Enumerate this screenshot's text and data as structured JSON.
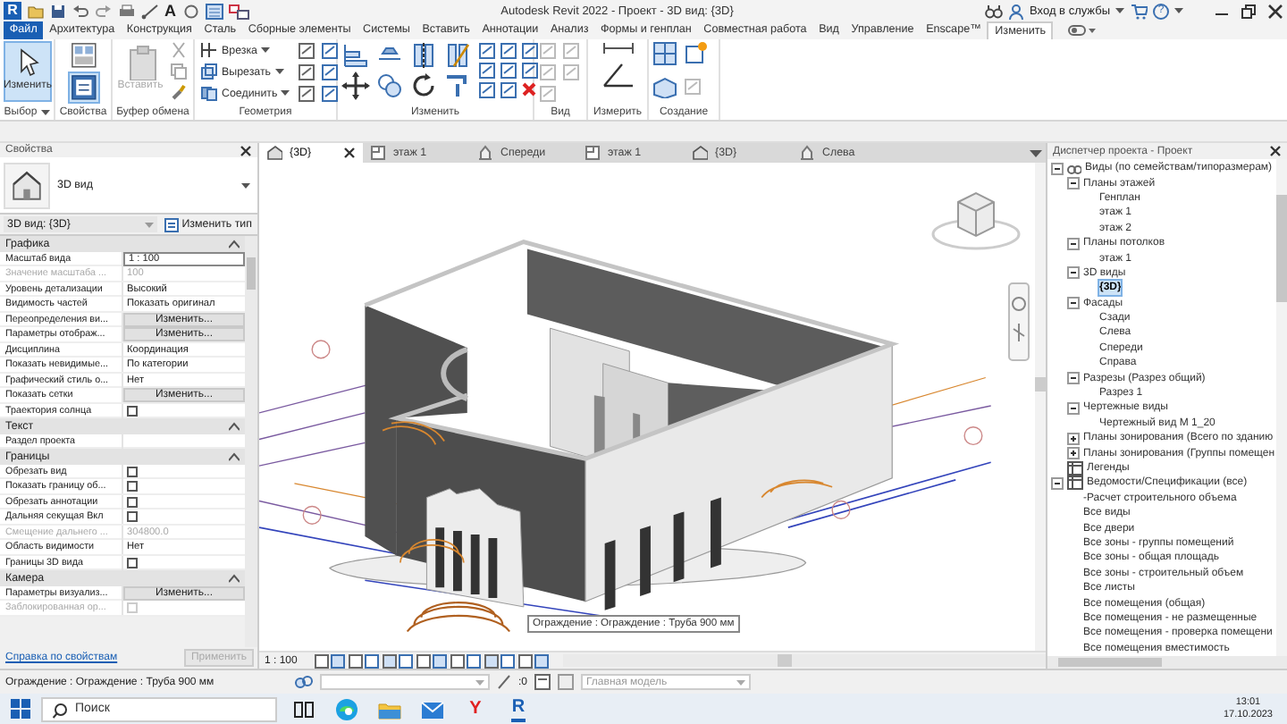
{
  "title_bar": {
    "logo": "R",
    "text_tool": "A",
    "title": "Autodesk Revit 2022 - Проект - 3D вид: {3D}",
    "sign_in": "Вход в службы",
    "help": "?"
  },
  "ribbon_tabs": [
    {
      "label": "Файл",
      "kind": "file",
      "selected": false
    },
    {
      "label": "Архитектура",
      "kind": "tab",
      "selected": false
    },
    {
      "label": "Конструкция",
      "kind": "tab",
      "selected": false
    },
    {
      "label": "Сталь",
      "kind": "tab",
      "selected": false
    },
    {
      "label": "Сборные элементы",
      "kind": "tab",
      "selected": false
    },
    {
      "label": "Системы",
      "kind": "tab",
      "selected": false
    },
    {
      "label": "Вставить",
      "kind": "tab",
      "selected": false
    },
    {
      "label": "Аннотации",
      "kind": "tab",
      "selected": false
    },
    {
      "label": "Анализ",
      "kind": "tab",
      "selected": false
    },
    {
      "label": "Формы и генплан",
      "kind": "tab",
      "selected": false
    },
    {
      "label": "Совместная работа",
      "kind": "tab",
      "selected": false
    },
    {
      "label": "Вид",
      "kind": "tab",
      "selected": false
    },
    {
      "label": "Управление",
      "kind": "tab",
      "selected": false
    },
    {
      "label": "Enscape™",
      "kind": "tab",
      "selected": false
    },
    {
      "label": "Изменить",
      "kind": "tab",
      "selected": true
    }
  ],
  "ribbon_panels": [
    {
      "kind": "select",
      "title": "Выбор",
      "buttons": [
        {
          "label": "Изменить",
          "selected": true
        }
      ]
    },
    {
      "kind": "properties",
      "title": "Свойства"
    },
    {
      "kind": "clipboard",
      "title": "Буфер обмена",
      "buttons": [
        {
          "label": "Вставить",
          "disabled": true
        }
      ]
    },
    {
      "kind": "geometry",
      "title": "Геометрия",
      "buttons": [
        {
          "label": "Врезка"
        },
        {
          "label": "Вырезать"
        },
        {
          "label": "Соединить"
        }
      ]
    },
    {
      "kind": "modify",
      "title": "Изменить"
    },
    {
      "kind": "view",
      "title": "Вид"
    },
    {
      "kind": "measure",
      "title": "Измерить"
    },
    {
      "kind": "create",
      "title": "Создание"
    }
  ],
  "properties": {
    "title": "Свойства",
    "type_name": "3D вид",
    "instance": "3D вид: {3D}",
    "edit_type": "Изменить тип",
    "groups": [
      {
        "name": "Графика",
        "rows": [
          {
            "label": "Масштаб вида",
            "kind": "input",
            "value": "1 : 100"
          },
          {
            "label": "Значение масштаба ...",
            "kind": "text",
            "value": "100",
            "disabled": true
          },
          {
            "label": "Уровень детализации",
            "kind": "text",
            "value": "Высокий"
          },
          {
            "label": "Видимость частей",
            "kind": "text",
            "value": "Показать оригинал"
          },
          {
            "label": "Переопределения ви...",
            "kind": "button",
            "value": "Изменить..."
          },
          {
            "label": "Параметры отображ...",
            "kind": "button",
            "value": "Изменить..."
          },
          {
            "label": "Дисциплина",
            "kind": "text",
            "value": "Координация"
          },
          {
            "label": "Показать невидимые...",
            "kind": "text",
            "value": "По категории"
          },
          {
            "label": "Графический стиль о...",
            "kind": "text",
            "value": "Нет"
          },
          {
            "label": "Показать сетки",
            "kind": "button",
            "value": "Изменить..."
          },
          {
            "label": "Траектория солнца",
            "kind": "checkbox",
            "checked": false
          }
        ]
      },
      {
        "name": "Текст",
        "rows": [
          {
            "label": "Раздел проекта",
            "kind": "text"
          }
        ]
      },
      {
        "name": "Границы",
        "rows": [
          {
            "label": "Обрезать вид",
            "kind": "checkbox",
            "checked": false
          },
          {
            "label": "Показать границу об...",
            "kind": "checkbox",
            "checked": false
          },
          {
            "label": "Обрезать аннотации",
            "kind": "checkbox",
            "checked": false
          },
          {
            "label": "Дальняя секущая Вкл",
            "kind": "checkbox",
            "checked": false
          },
          {
            "label": "Смещение дальнего ...",
            "kind": "text",
            "value": "304800.0",
            "disabled": true
          },
          {
            "label": "Область видимости",
            "kind": "text",
            "value": "Нет"
          },
          {
            "label": "Границы 3D вида",
            "kind": "checkbox",
            "checked": false
          }
        ]
      },
      {
        "name": "Камера",
        "rows": [
          {
            "label": "Параметры визуализ...",
            "kind": "button",
            "value": "Изменить..."
          },
          {
            "label": "Заблокированная ор...",
            "kind": "checkbox",
            "checked": false,
            "disabled": true
          }
        ]
      }
    ],
    "help_link": "Справка по свойствам",
    "apply": {
      "label": "Применить",
      "disabled": true
    }
  },
  "view_tabs": [
    {
      "label": "{3D}",
      "kind": "threed",
      "selected": true
    },
    {
      "label": "этаж 1",
      "kind": "plan",
      "selected": false
    },
    {
      "label": "Спереди",
      "kind": "elevation",
      "selected": false
    },
    {
      "label": "этаж 1",
      "kind": "plan",
      "selected": false
    },
    {
      "label": "{3D}",
      "kind": "threed",
      "selected": false
    },
    {
      "label": "Слева",
      "kind": "elevation",
      "selected": false
    }
  ],
  "canvas": {
    "tooltip": "Ограждение : Ограждение : Труба 900 мм"
  },
  "view_bar": {
    "scale": "1 : 100"
  },
  "status_bar": {
    "message": "Ограждение : Ограждение : Труба 900 мм",
    "worksets_value": ":0",
    "model": "Главная модель"
  },
  "project_browser": {
    "title": "Диспетчер проекта - Проект",
    "tree": [
      {
        "label": "Виды (по семействам/типоразмерам)",
        "expanded": true,
        "children": [
          {
            "label": "Планы этажей",
            "expanded": true,
            "children": [
              {
                "label": "Генплан"
              },
              {
                "label": "этаж 1"
              },
              {
                "label": "этаж 2"
              }
            ]
          },
          {
            "label": "Планы потолков",
            "expanded": true,
            "children": [
              {
                "label": "этаж 1"
              }
            ]
          },
          {
            "label": "3D виды",
            "expanded": true,
            "children": [
              {
                "label": "{3D}",
                "selected": true
              }
            ]
          },
          {
            "label": "Фасады",
            "expanded": true,
            "children": [
              {
                "label": "Сзади"
              },
              {
                "label": "Слева"
              },
              {
                "label": "Спереди"
              },
              {
                "label": "Справа"
              }
            ]
          },
          {
            "label": "Разрезы (Разрез общий)",
            "expanded": true,
            "children": [
              {
                "label": "Разрез 1"
              }
            ]
          },
          {
            "label": "Чертежные виды",
            "expanded": true,
            "children": [
              {
                "label": "Чертежный вид М 1_20"
              }
            ]
          },
          {
            "label": "Планы зонирования (Всего по зданию",
            "expanded": false
          },
          {
            "label": "Планы зонирования (Группы помещен",
            "expanded": false
          }
        ]
      },
      {
        "label": "Легенды"
      },
      {
        "label": "Ведомости/Спецификации (все)",
        "expanded": true,
        "children": [
          {
            "label": "-Расчет строительного объема"
          },
          {
            "label": "Все виды"
          },
          {
            "label": "Все двери"
          },
          {
            "label": "Все зоны - группы помещений"
          },
          {
            "label": "Все зоны - общая площадь"
          },
          {
            "label": "Все зоны - строительный объем"
          },
          {
            "label": "Все листы"
          },
          {
            "label": "Все помещения (общая)"
          },
          {
            "label": "Все помещения - не размещенные"
          },
          {
            "label": "Все помещения - проверка помещени"
          },
          {
            "label": "Все помещения вместимость"
          }
        ]
      }
    ]
  },
  "taskbar": {
    "search": {
      "placeholder": "Поиск"
    },
    "apps": [
      {
        "kind": "task_view"
      },
      {
        "kind": "edge"
      },
      {
        "kind": "explorer"
      },
      {
        "kind": "mail"
      },
      {
        "kind": "letter",
        "letter": "Y"
      },
      {
        "kind": "letter",
        "letter": "R"
      }
    ],
    "time": "13:01",
    "date": "17.10.2023"
  }
}
